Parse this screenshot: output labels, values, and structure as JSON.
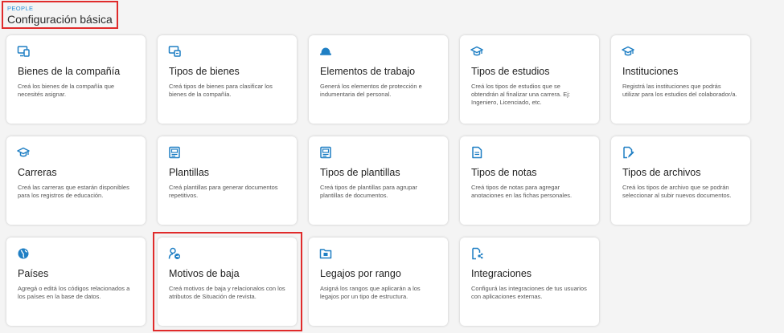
{
  "header": {
    "eyebrow": "PEOPLE",
    "title": "Configuración básica"
  },
  "colors": {
    "accent": "#1f7fc4",
    "highlight": "#e02b2b"
  },
  "cards": [
    {
      "name": "Bienes de la compañía",
      "desc": "Creá los bienes de la compañía que necesités asignar.",
      "icon": "assets-icon"
    },
    {
      "name": "Tipos de bienes",
      "desc": "Creá tipos de bienes para clasificar los bienes de la compañía.",
      "icon": "asset-types-icon"
    },
    {
      "name": "Elementos de trabajo",
      "desc": "Generá los elementos de protección e indumentaria del personal.",
      "icon": "hardhat-icon"
    },
    {
      "name": "Tipos de estudios",
      "desc": "Creá los tipos de estudios que se obtendrán al finalizar una carrera. Ej: Ingeniero, Licenciado, etc.",
      "icon": "graduation-cap-icon"
    },
    {
      "name": "Instituciones",
      "desc": "Registrá las instituciones que podrás utilizar para los estudios del colaborador/a.",
      "icon": "graduation-cap-icon"
    },
    {
      "name": "Carreras",
      "desc": "Creá las carreras que estarán disponibles para los registros de educación.",
      "icon": "graduation-cap-icon"
    },
    {
      "name": "Plantillas",
      "desc": "Creá plantillas para generar documentos repetitivos.",
      "icon": "template-icon"
    },
    {
      "name": "Tipos de plantillas",
      "desc": "Creá tipos de plantillas para agrupar plantillas de documentos.",
      "icon": "template-icon"
    },
    {
      "name": "Tipos de notas",
      "desc": "Creá tipos de notas para agregar anotaciones en las fichas personales.",
      "icon": "note-icon"
    },
    {
      "name": "Tipos de archivos",
      "desc": "Creá los tipos de archivo que se podrán seleccionar al subir nuevos documentos.",
      "icon": "file-edit-icon"
    },
    {
      "name": "Países",
      "desc": "Agregá o editá los códigos relacionados a los países en la base de datos.",
      "icon": "globe-icon"
    },
    {
      "name": "Motivos de baja",
      "desc": "Creá motivos de baja y relacionalos con los atributos de Situación de revista.",
      "icon": "user-exit-icon"
    },
    {
      "name": "Legajos por rango",
      "desc": "Asigná los rangos que aplicarán a los legajos por un tipo de estructura.",
      "icon": "folder-range-icon"
    },
    {
      "name": "Integraciones",
      "desc": "Configurá las integraciones de tus usuarios con aplicaciones externas.",
      "icon": "integration-icon"
    }
  ]
}
